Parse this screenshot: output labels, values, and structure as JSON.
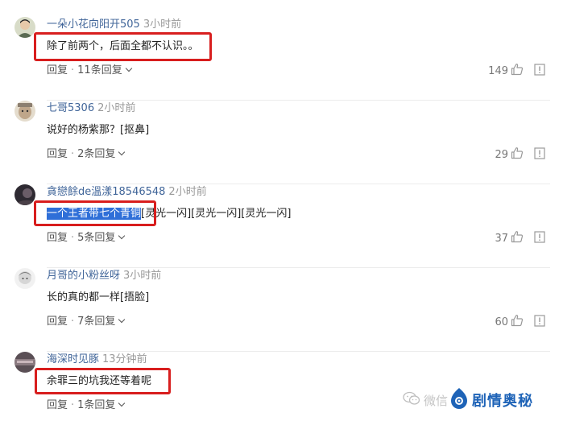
{
  "comments": [
    {
      "username": "一朵小花向阳开505",
      "time": "3小时前",
      "text": "除了前两个，后面全都不认识。。",
      "reply_label": "回复",
      "replies": "11条回复",
      "likes": "149"
    },
    {
      "username": "七哥5306",
      "time": "2小时前",
      "text": "说好的杨紫那？[抠鼻]",
      "reply_label": "回复",
      "replies": "2条回复",
      "likes": "29"
    },
    {
      "username": "貪戀餘de溫漾18546548",
      "time": "2小时前",
      "text_highlight": "一个王者带七个青铜",
      "text_rest": "[灵光一闪][灵光一闪][灵光一闪]",
      "reply_label": "回复",
      "replies": "5条回复",
      "likes": "37"
    },
    {
      "username": "月哥的小粉丝呀",
      "time": "3小时前",
      "text": "长的真的都一样[捂脸]",
      "reply_label": "回复",
      "replies": "7条回复",
      "likes": "60"
    },
    {
      "username": "海深时见豚",
      "time": "13分钟前",
      "text": "余罪三的坑我还等着呢",
      "reply_label": "回复",
      "replies": "1条回复"
    }
  ],
  "watermark": {
    "faint_text": "微信",
    "brand": "剧情奥秘"
  },
  "icons": {
    "like": "thumb-up-icon",
    "report": "report-icon",
    "expand": "chevron-down-icon",
    "watermark_app": "wechat-icon",
    "watermark_logo": "brand-logo-icon"
  },
  "colors": {
    "username": "#406599",
    "highlight": "#2f6fd8",
    "annotation_box": "#d81e1e",
    "brand": "#1e63b7"
  }
}
